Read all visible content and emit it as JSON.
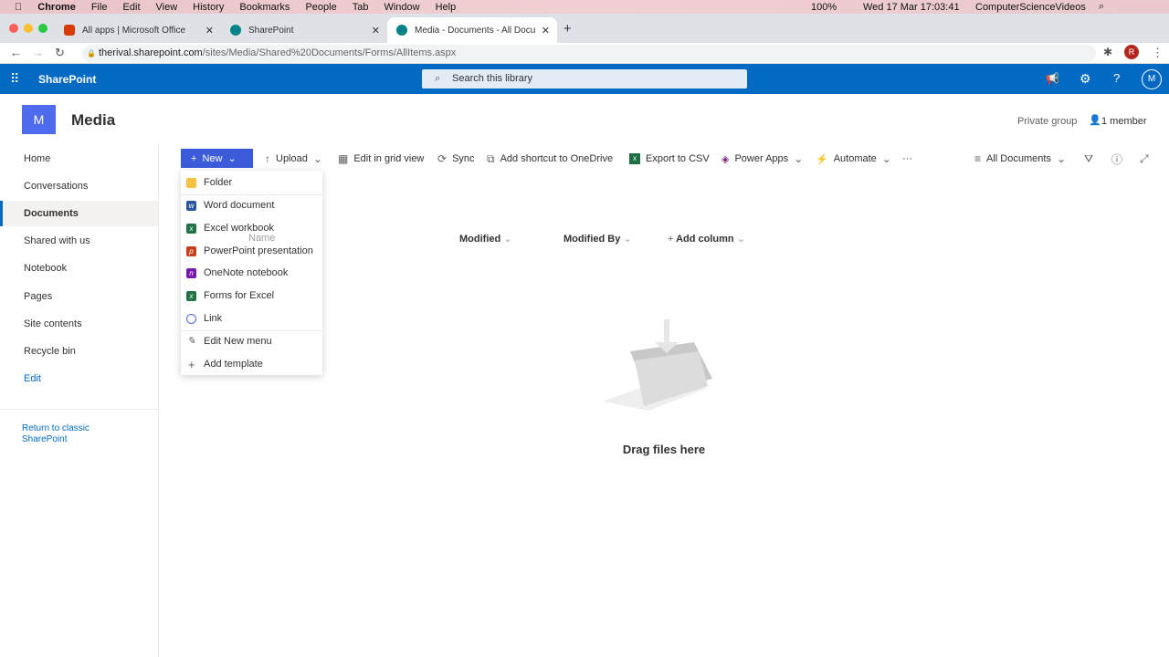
{
  "mac": {
    "app": "Chrome",
    "menus": [
      "File",
      "Edit",
      "View",
      "History",
      "Bookmarks",
      "People",
      "Tab",
      "Window",
      "Help"
    ],
    "battery": "100%",
    "datetime": "Wed 17 Mar  17:03:41",
    "user": "ComputerScienceVideos"
  },
  "browser": {
    "tabs": [
      {
        "title": "All apps | Microsoft Office"
      },
      {
        "title": "SharePoint"
      },
      {
        "title": "Media - Documents - All Docu"
      }
    ],
    "url_host": "therival.sharepoint.com",
    "url_path": "/sites/Media/Shared%20Documents/Forms/AllItems.aspx",
    "profile": "R"
  },
  "sp": {
    "brand": "SharePoint",
    "search_placeholder": "Search this library",
    "avatar": "M",
    "accent": "#036ac4"
  },
  "site": {
    "logo_letter": "M",
    "title": "Media",
    "group": "Private group",
    "members": "1 member"
  },
  "nav": {
    "items": [
      "Home",
      "Conversations",
      "Documents",
      "Shared with us",
      "Notebook",
      "Pages",
      "Site contents",
      "Recycle bin"
    ],
    "edit": "Edit",
    "classic": "Return to classic SharePoint"
  },
  "toolbar": {
    "new": "New",
    "upload": "Upload",
    "grid": "Edit in grid view",
    "sync": "Sync",
    "shortcut": "Add shortcut to OneDrive",
    "export": "Export to CSV",
    "powerapps": "Power Apps",
    "automate": "Automate",
    "more": "···",
    "view": "All Documents"
  },
  "new_menu": {
    "items": [
      "Folder",
      "Word document",
      "Excel workbook",
      "PowerPoint presentation",
      "OneNote notebook",
      "Forms for Excel",
      "Link",
      "Edit New menu",
      "Add template"
    ]
  },
  "columns": {
    "name": "Name",
    "modified": "Modified",
    "modified_by": "Modified By",
    "add": "Add column"
  },
  "empty": {
    "text": "Drag files here"
  }
}
